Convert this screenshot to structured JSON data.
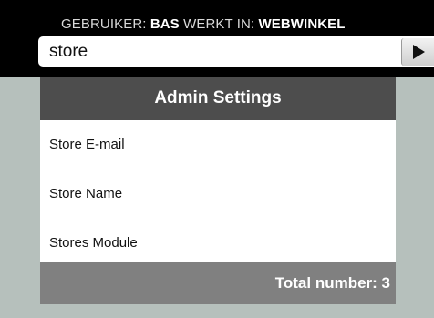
{
  "header": {
    "user_label": "GEBRUIKER:",
    "user_name": "BAS",
    "workspace_label": "WERKT IN:",
    "workspace_name": "WEBWINKEL"
  },
  "search": {
    "value": "store",
    "button_icon": "play-icon"
  },
  "panel": {
    "title": "Admin Settings",
    "items": [
      {
        "label": "Store E-mail"
      },
      {
        "label": "Store Name"
      },
      {
        "label": "Stores Module"
      }
    ],
    "footer": "Total number: 3"
  },
  "colors": {
    "background": "#b6c0bc",
    "topbar": "#000000",
    "panel_header": "#4d4d4d",
    "panel_footer": "#808080"
  }
}
